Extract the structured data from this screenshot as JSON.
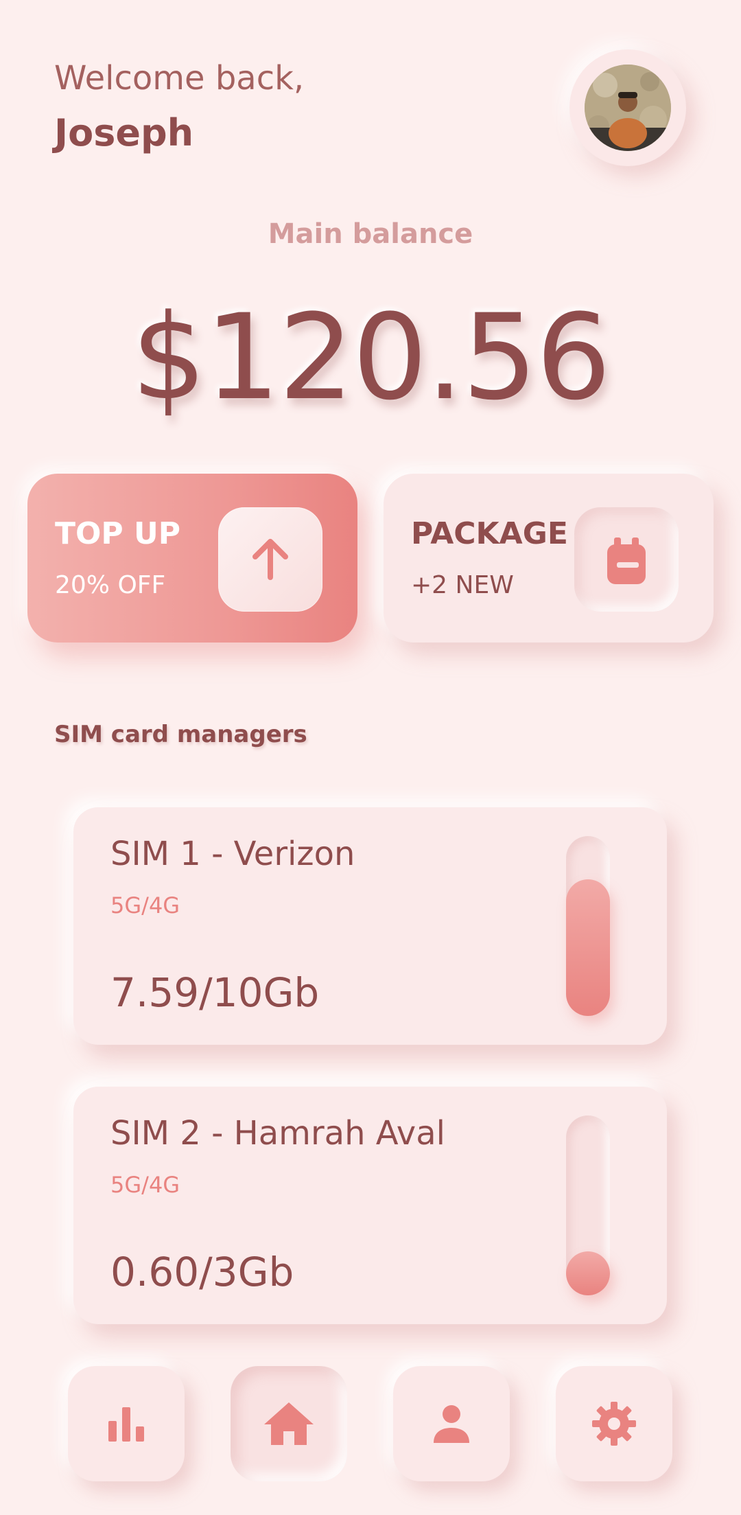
{
  "header": {
    "greeting": "Welcome back,",
    "user_name": "Joseph"
  },
  "balance": {
    "label": "Main balance",
    "amount": "$120.56"
  },
  "actions": [
    {
      "title": "TOP UP",
      "subtitle": "20% OFF",
      "icon": "arrow-up-icon"
    },
    {
      "title": "PACKAGE",
      "subtitle": "+2 NEW",
      "icon": "backpack-icon"
    }
  ],
  "sims": {
    "section_label": "SIM card managers",
    "items": [
      {
        "name": "SIM 1 - Verizon",
        "network": "5G/4G",
        "usage": "7.59/10Gb",
        "used_fraction": 0.759
      },
      {
        "name": "SIM 2 - Hamrah Aval",
        "network": "5G/4G",
        "usage": "0.60/3Gb",
        "used_fraction": 0.2
      }
    ]
  },
  "nav": [
    {
      "icon": "bar-chart-icon",
      "active": false
    },
    {
      "icon": "home-icon",
      "active": true
    },
    {
      "icon": "person-icon",
      "active": false
    },
    {
      "icon": "gear-icon",
      "active": false
    }
  ],
  "colors": {
    "background": "#fdefee",
    "accent": "#e98380",
    "text_dark": "#8f4d4d",
    "text_muted": "#d49c9c"
  }
}
